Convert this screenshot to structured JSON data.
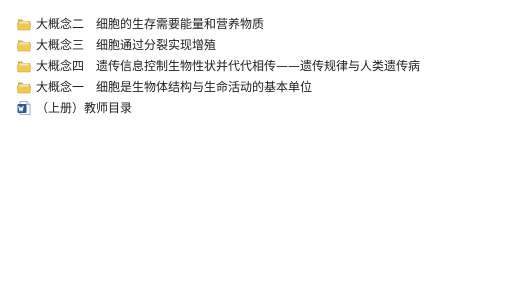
{
  "files": [
    {
      "icon": "folder-icon",
      "name": "大概念二　细胞的生存需要能量和营养物质"
    },
    {
      "icon": "folder-icon",
      "name": "大概念三　细胞通过分裂实现增殖"
    },
    {
      "icon": "folder-icon",
      "name": "大概念四　遗传信息控制生物性状并代代相传——遗传规律与人类遗传病"
    },
    {
      "icon": "folder-icon",
      "name": "大概念一　细胞是生物体结构与生命活动的基本单位"
    },
    {
      "icon": "word-doc-icon",
      "name": "（上册）教师目录"
    }
  ]
}
